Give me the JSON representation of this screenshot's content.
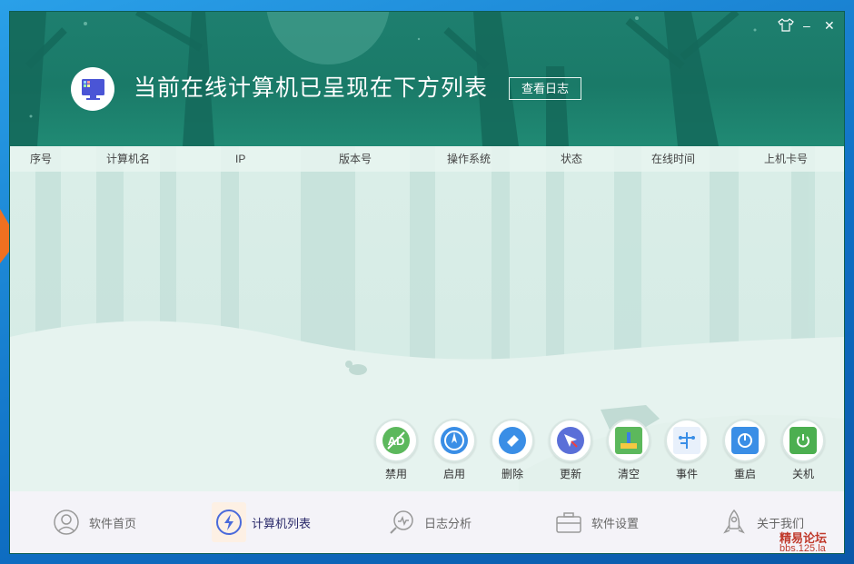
{
  "window": {
    "title": "当前在线计算机已呈现在下方列表",
    "view_log_button": "查看日志",
    "controls": {
      "skin": "skin-icon",
      "minimize": "–",
      "close": "✕"
    }
  },
  "table": {
    "columns": [
      "序号",
      "计算机名",
      "IP",
      "版本号",
      "操作系统",
      "状态",
      "在线时间",
      "上机卡号"
    ],
    "rows": []
  },
  "actions": [
    {
      "label": "禁用",
      "icon": "ad-block-icon",
      "color": "#5cb85c"
    },
    {
      "label": "启用",
      "icon": "compass-icon",
      "color": "#3a8ee6"
    },
    {
      "label": "删除",
      "icon": "eraser-icon",
      "color": "#3a8ee6"
    },
    {
      "label": "更新",
      "icon": "navigate-icon",
      "color": "#5a6fd8"
    },
    {
      "label": "清空",
      "icon": "clean-brush-icon",
      "color": "#5cb85c"
    },
    {
      "label": "事件",
      "icon": "event-tree-icon",
      "color": "#3a8ee6"
    },
    {
      "label": "重启",
      "icon": "restart-icon",
      "color": "#3a8ee6"
    },
    {
      "label": "关机",
      "icon": "power-icon",
      "color": "#4caf50"
    }
  ],
  "nav": [
    {
      "label": "软件首页",
      "icon": "user-avatar-icon"
    },
    {
      "label": "计算机列表",
      "icon": "lightning-icon",
      "active": true
    },
    {
      "label": "日志分析",
      "icon": "log-analysis-icon"
    },
    {
      "label": "软件设置",
      "icon": "toolbox-icon"
    },
    {
      "label": "关于我们",
      "icon": "rocket-icon"
    }
  ],
  "watermark": {
    "line1": "精易论坛",
    "line2": "bbs.125.la"
  },
  "colors": {
    "accent": "#1e7f6f",
    "nav_bg": "#f4f3f8",
    "content_bg": "#dbeee8"
  }
}
